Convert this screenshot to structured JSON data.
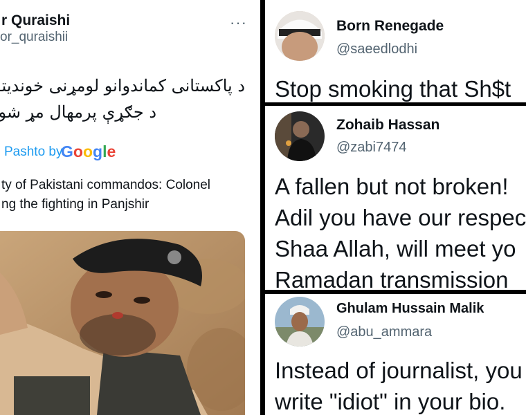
{
  "left_tweet": {
    "name": "r Quraishi",
    "handle": "or_quraishii",
    "more": "···",
    "pashto_line1": "د پاکستانی کماندوانو لومړنی خوندیتوب کرنل عا",
    "pashto_line2": "د جګړې پرمهال مړ شو",
    "translated_label": "Pashto by",
    "google": [
      "G",
      "o",
      "o",
      "g",
      "l",
      "e"
    ],
    "google_colors": [
      "#4285F4",
      "#EA4335",
      "#FBBC05",
      "#4285F4",
      "#34A853",
      "#EA4335"
    ],
    "translation_line1": "ty of Pakistani commandos: Colonel",
    "translation_line2": "ng the fighting in Panjshir"
  },
  "replies": [
    {
      "name": "Born Renegade",
      "handle": "@saeedlodhi",
      "lines": [
        "Stop smoking that Sh$t"
      ]
    },
    {
      "name": "Zohaib Hassan",
      "handle": "@zabi7474",
      "lines": [
        "A fallen but not broken!",
        "Adil you have our respec",
        "Shaa Allah, will meet yo",
        "Ramadan transmission"
      ]
    },
    {
      "name": "Ghulam Hussain Malik",
      "handle": "@abu_ammara",
      "lines": [
        "Instead of journalist, you",
        "write \"idiot\" in your bio."
      ]
    }
  ]
}
